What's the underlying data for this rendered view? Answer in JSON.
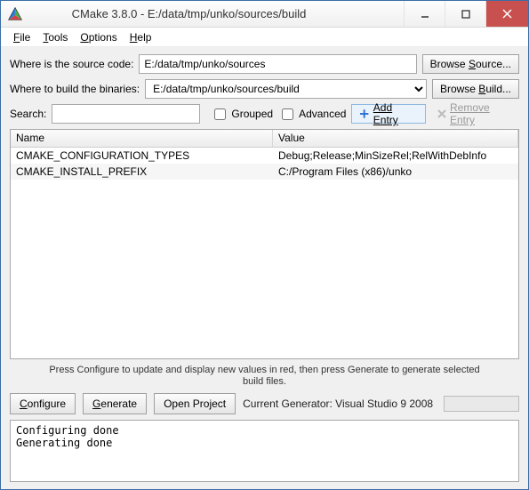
{
  "title": "CMake 3.8.0 - E:/data/tmp/unko/sources/build",
  "menu": {
    "file": "File",
    "tools": "Tools",
    "options": "Options",
    "help": "Help"
  },
  "source": {
    "label": "Where is the source code:",
    "value": "E:/data/tmp/unko/sources",
    "browse": "Browse Source..."
  },
  "build": {
    "label": "Where to build the binaries:",
    "value": "E:/data/tmp/unko/sources/build",
    "browse": "Browse Build..."
  },
  "search": {
    "label": "Search:",
    "value": ""
  },
  "grouped": "Grouped",
  "advanced": "Advanced",
  "add_entry": "Add Entry",
  "remove_entry": "Remove Entry",
  "columns": {
    "name": "Name",
    "value": "Value"
  },
  "rows": [
    {
      "name": "CMAKE_CONFIGURATION_TYPES",
      "value": "Debug;Release;MinSizeRel;RelWithDebInfo"
    },
    {
      "name": "CMAKE_INSTALL_PREFIX",
      "value": "C:/Program Files (x86)/unko"
    }
  ],
  "hint": "Press Configure to update and display new values in red, then press Generate to generate selected build files.",
  "buttons": {
    "configure": "Configure",
    "generate": "Generate",
    "open_project": "Open Project"
  },
  "generator": "Current Generator: Visual Studio 9 2008",
  "log": "Configuring done\nGenerating done"
}
